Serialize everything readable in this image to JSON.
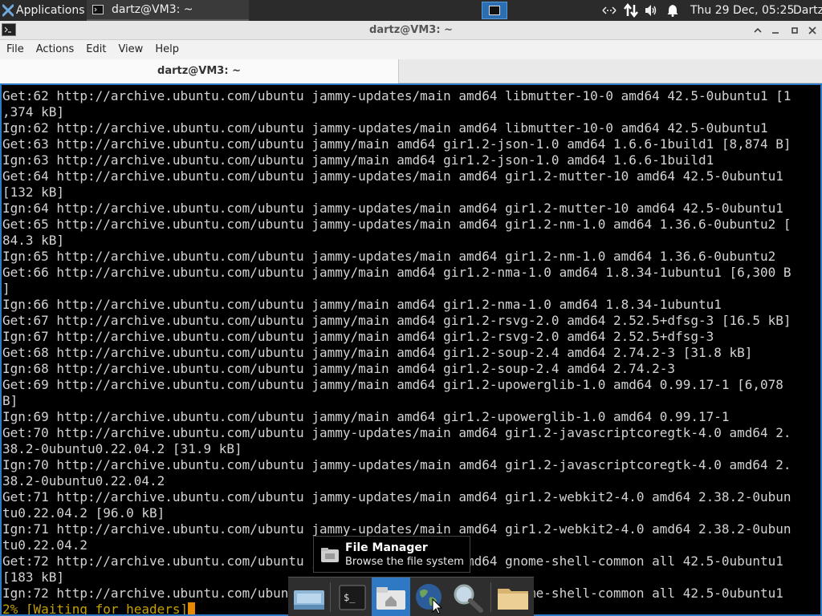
{
  "panel": {
    "applications_label": "Applications",
    "task_label": "dartz@VM3: ~",
    "clock": "Thu 29 Dec, 05:25",
    "user": "Dartz"
  },
  "window": {
    "title": "dartz@VM3: ~",
    "tab_label": "dartz@VM3: ~"
  },
  "menu": {
    "file": "File",
    "actions": "Actions",
    "edit": "Edit",
    "view": "View",
    "help": "Help"
  },
  "terminal": {
    "lines": [
      "Get:62 http://archive.ubuntu.com/ubuntu jammy-updates/main amd64 libmutter-10-0 amd64 42.5-0ubuntu1 [1",
      ",374 kB]",
      "Ign:62 http://archive.ubuntu.com/ubuntu jammy-updates/main amd64 libmutter-10-0 amd64 42.5-0ubuntu1",
      "Get:63 http://archive.ubuntu.com/ubuntu jammy/main amd64 gir1.2-json-1.0 amd64 1.6.6-1build1 [8,874 B]",
      "Ign:63 http://archive.ubuntu.com/ubuntu jammy/main amd64 gir1.2-json-1.0 amd64 1.6.6-1build1",
      "Get:64 http://archive.ubuntu.com/ubuntu jammy-updates/main amd64 gir1.2-mutter-10 amd64 42.5-0ubuntu1",
      "[132 kB]",
      "Ign:64 http://archive.ubuntu.com/ubuntu jammy-updates/main amd64 gir1.2-mutter-10 amd64 42.5-0ubuntu1",
      "Get:65 http://archive.ubuntu.com/ubuntu jammy-updates/main amd64 gir1.2-nm-1.0 amd64 1.36.6-0ubuntu2 [",
      "84.3 kB]",
      "Ign:65 http://archive.ubuntu.com/ubuntu jammy-updates/main amd64 gir1.2-nm-1.0 amd64 1.36.6-0ubuntu2",
      "Get:66 http://archive.ubuntu.com/ubuntu jammy/main amd64 gir1.2-nma-1.0 amd64 1.8.34-1ubuntu1 [6,300 B",
      "]",
      "Ign:66 http://archive.ubuntu.com/ubuntu jammy/main amd64 gir1.2-nma-1.0 amd64 1.8.34-1ubuntu1",
      "Get:67 http://archive.ubuntu.com/ubuntu jammy/main amd64 gir1.2-rsvg-2.0 amd64 2.52.5+dfsg-3 [16.5 kB]",
      "Ign:67 http://archive.ubuntu.com/ubuntu jammy/main amd64 gir1.2-rsvg-2.0 amd64 2.52.5+dfsg-3",
      "Get:68 http://archive.ubuntu.com/ubuntu jammy/main amd64 gir1.2-soup-2.4 amd64 2.74.2-3 [31.8 kB]",
      "Ign:68 http://archive.ubuntu.com/ubuntu jammy/main amd64 gir1.2-soup-2.4 amd64 2.74.2-3",
      "Get:69 http://archive.ubuntu.com/ubuntu jammy/main amd64 gir1.2-upowerglib-1.0 amd64 0.99.17-1 [6,078",
      "B]",
      "Ign:69 http://archive.ubuntu.com/ubuntu jammy/main amd64 gir1.2-upowerglib-1.0 amd64 0.99.17-1",
      "Get:70 http://archive.ubuntu.com/ubuntu jammy-updates/main amd64 gir1.2-javascriptcoregtk-4.0 amd64 2.",
      "38.2-0ubuntu0.22.04.2 [31.9 kB]",
      "Ign:70 http://archive.ubuntu.com/ubuntu jammy-updates/main amd64 gir1.2-javascriptcoregtk-4.0 amd64 2.",
      "38.2-0ubuntu0.22.04.2",
      "Get:71 http://archive.ubuntu.com/ubuntu jammy-updates/main amd64 gir1.2-webkit2-4.0 amd64 2.38.2-0ubun",
      "tu0.22.04.2 [96.0 kB]",
      "Ign:71 http://archive.ubuntu.com/ubuntu jammy-updates/main amd64 gir1.2-webkit2-4.0 amd64 2.38.2-0ubun",
      "tu0.22.04.2",
      "Get:72 http://archive.ubuntu.com/ubuntu jammy-updates/main amd64 gnome-shell-common all 42.5-0ubuntu1",
      "[183 kB]",
      "Ign:72 http://archive.ubuntu.com/ubuntu jammy-updates/main amd64 gnome-shell-common all 42.5-0ubuntu1"
    ],
    "status": "2% [Waiting for headers]"
  },
  "tooltip": {
    "title": "File Manager",
    "subtitle": "Browse the file system"
  },
  "colors": {
    "accent": "#2f78c4",
    "status_text": "#c4a000",
    "cursor": "#e58a00"
  }
}
